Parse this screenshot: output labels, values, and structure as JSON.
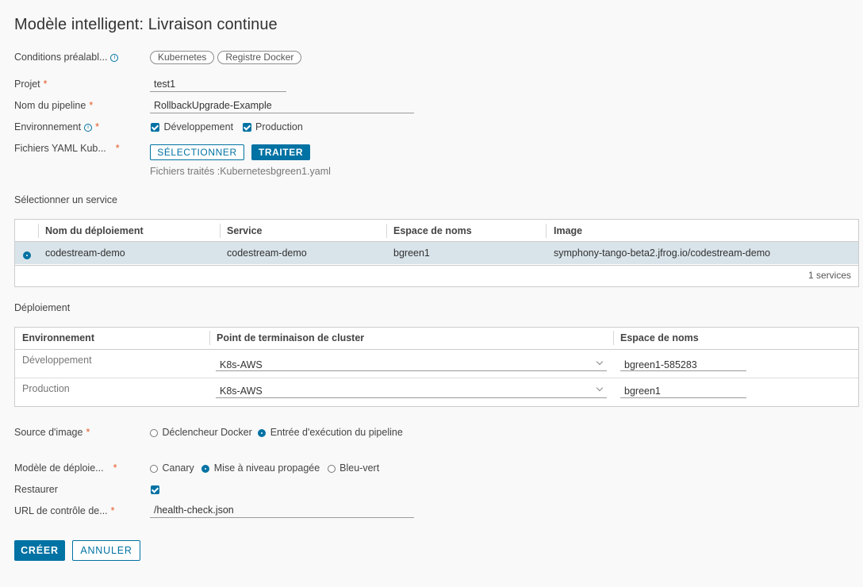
{
  "page": {
    "title": "Modèle intelligent: Livraison continue"
  },
  "prereq": {
    "label": "Conditions préalabl...",
    "chips": [
      "Kubernetes",
      "Registre Docker"
    ]
  },
  "info_glyph": "i",
  "project": {
    "label": "Projet",
    "value": "test1"
  },
  "pipeline_name": {
    "label": "Nom du pipeline",
    "value": "RollbackUpgrade-Example"
  },
  "environment": {
    "label": "Environnement",
    "options": [
      "Développement",
      "Production"
    ]
  },
  "yaml": {
    "label": "Fichiers YAML Kub...",
    "select_label": "SÉLECTIONNER",
    "process_label": "TRAITER",
    "processed_text": "Fichiers traités :Kubernetesbgreen1.yaml"
  },
  "required_mark": "*",
  "service_section": {
    "title": "Sélectionner un service",
    "columns": [
      "Nom du déploiement",
      "Service",
      "Espace de noms",
      "Image"
    ],
    "rows": [
      {
        "deployment": "codestream-demo",
        "service": "codestream-demo",
        "namespace": "bgreen1",
        "image": "symphony-tango-beta2.jfrog.io/codestream-demo"
      }
    ],
    "footer": "1 services"
  },
  "deployment_section": {
    "title": "Déploiement",
    "columns": [
      "Environnement",
      "Point de terminaison de cluster",
      "Espace de noms"
    ],
    "rows": [
      {
        "environment": "Développement",
        "cluster": "K8s-AWS",
        "namespace": "bgreen1-585283"
      },
      {
        "environment": "Production",
        "cluster": "K8s-AWS",
        "namespace": "bgreen1"
      }
    ]
  },
  "image_source": {
    "label": "Source d'image",
    "options": [
      "Déclencheur Docker",
      "Entrée d'exécution du pipeline"
    ],
    "selected": "Entrée d'exécution du pipeline"
  },
  "deploy_model": {
    "label": "Modèle de déploie...",
    "options": [
      "Canary",
      "Mise à niveau propagée",
      "Bleu-vert"
    ],
    "selected": "Mise à niveau propagée"
  },
  "restore": {
    "label": "Restaurer",
    "checked": true
  },
  "health_url": {
    "label": "URL de contrôle de...",
    "value": "/health-check.json"
  },
  "actions": {
    "create_label": "CRÉER",
    "cancel_label": "ANNULER"
  },
  "colors": {
    "accent": "#0072a3",
    "required": "#e35a26",
    "selected_row": "#d9e4ea"
  }
}
